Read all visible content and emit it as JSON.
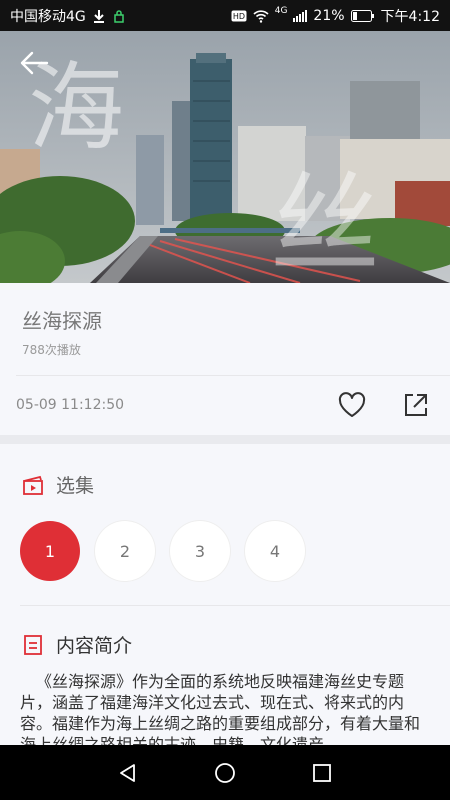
{
  "status_bar": {
    "carrier": "中国移动4G",
    "network_badge": "4G",
    "battery": "21%",
    "time": "下午4:12",
    "icons": [
      "download-icon",
      "lock-icon",
      "hd-icon",
      "wifi-icon",
      "signal-icon",
      "battery-icon"
    ]
  },
  "hero": {
    "watermark_chars": [
      "海",
      "丝"
    ],
    "back_icon": "back-arrow-icon"
  },
  "program": {
    "title": "丝海探源",
    "plays": "788次播放",
    "date": "05-09 11:12:50",
    "favorite_icon": "heart-icon",
    "share_icon": "share-icon"
  },
  "episodes_section": {
    "title": "选集",
    "icon": "clapperboard-icon",
    "items": [
      "1",
      "2",
      "3",
      "4"
    ],
    "active_index": 0
  },
  "intro_section": {
    "title": "内容简介",
    "icon": "document-icon",
    "text": "《丝海探源》作为全面的系统地反映福建海丝史专题片，涵盖了福建海洋文化过去式、现在式、将来式的内容。福建作为海上丝绸之路的重要组成部分，有着大量和海上丝绸之路相关的古迹、史籍、文化遗产"
  },
  "nav_bar": {
    "icons": [
      "back-triangle-icon",
      "home-circle-icon",
      "recents-square-icon"
    ]
  },
  "colors": {
    "accent": "#df2f36",
    "status_bar": "#121212",
    "nav_bar": "#000000"
  }
}
